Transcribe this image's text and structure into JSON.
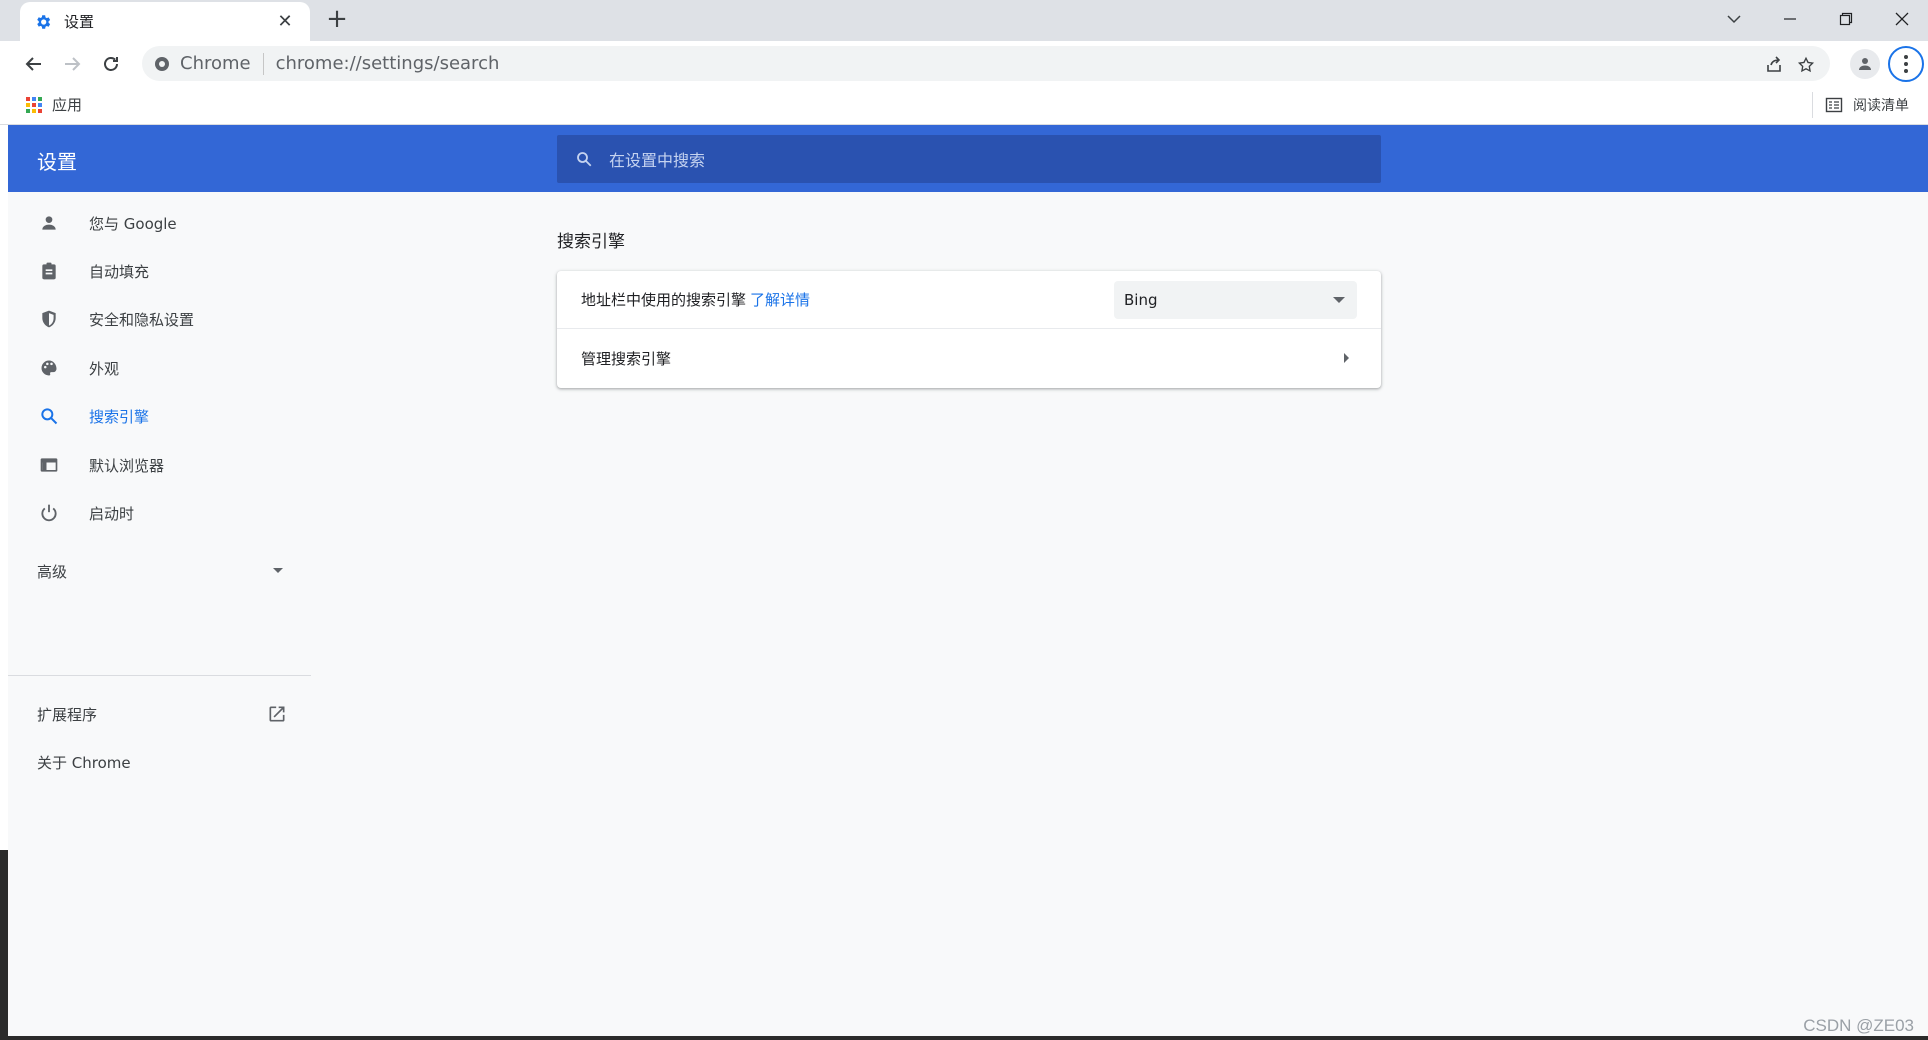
{
  "browser": {
    "tab": {
      "title": "设置",
      "close": "✕"
    },
    "new_tab": "+",
    "omnibox": {
      "scheme_label": "Chrome",
      "url": "chrome://settings/search"
    },
    "bookmarks": {
      "apps_label": "应用",
      "reading_list_label": "阅读清单"
    }
  },
  "settings": {
    "header_title": "设置",
    "search_placeholder": "在设置中搜索",
    "sidebar": {
      "items": [
        {
          "label": "您与 Google",
          "icon": "person-icon"
        },
        {
          "label": "自动填充",
          "icon": "clipboard-icon"
        },
        {
          "label": "安全和隐私设置",
          "icon": "shield-icon"
        },
        {
          "label": "外观",
          "icon": "palette-icon"
        },
        {
          "label": "搜索引擎",
          "icon": "search-icon",
          "active": true
        },
        {
          "label": "默认浏览器",
          "icon": "browser-window-icon"
        },
        {
          "label": "启动时",
          "icon": "power-icon"
        }
      ],
      "advanced_label": "高级",
      "extensions_label": "扩展程序",
      "about_label": "关于 Chrome"
    },
    "search_engine": {
      "section_title": "搜索引擎",
      "address_bar_label": "地址栏中使用的搜索引擎",
      "learn_more": "了解详情",
      "selected_engine": "Bing",
      "manage_label": "管理搜索引擎"
    }
  },
  "watermark": "CSDN @ZE03",
  "colors": {
    "accent": "#1a73e8",
    "header": "#3367d6",
    "search_box": "#2a52b0"
  }
}
